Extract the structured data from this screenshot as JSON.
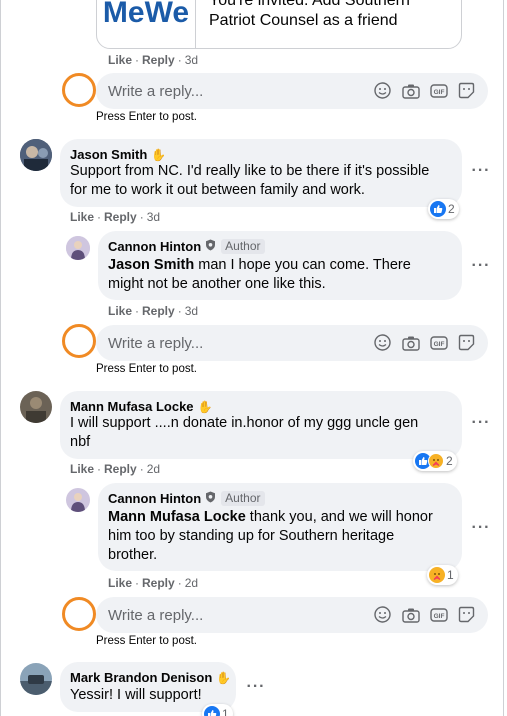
{
  "top_card": {
    "logo_text": "MeWe",
    "invite_line1": "You're invited. Add Southern",
    "invite_line2": "Patriot Counsel as a friend"
  },
  "comments": [
    {
      "id": "c0",
      "actions": {
        "like": "Like",
        "reply": "Reply",
        "time": "3d"
      },
      "reply_box": {
        "placeholder": "Write a reply...",
        "hint": "Press Enter to post."
      }
    },
    {
      "id": "c1",
      "author": "Jason Smith",
      "text": "Support from NC. I'd really like to be there if it's possible for me to work it out between family and work.",
      "text_line1": "Support from NC. I'd really like to be there if it's possible",
      "text_line2": "for me to work it out between family and work.",
      "actions": {
        "like": "Like",
        "reply": "Reply",
        "time": "3d"
      },
      "reaction_count": "2",
      "reply": {
        "author": "Cannon Hinton",
        "badge": "Author",
        "mention": "Jason Smith",
        "text_line1_rest": " man I hope you can come. There",
        "text_line2": "might not be another one like this.",
        "actions": {
          "like": "Like",
          "reply": "Reply",
          "time": "3d"
        }
      },
      "reply_box": {
        "placeholder": "Write a reply...",
        "hint": "Press Enter to post."
      }
    },
    {
      "id": "c2",
      "author": "Mann Mufasa Locke",
      "text_line1": "I will support ....n donate in.honor of my ggg uncle gen",
      "text_line2": "nbf",
      "actions": {
        "like": "Like",
        "reply": "Reply",
        "time": "2d"
      },
      "reaction_count": "2",
      "reply": {
        "author": "Cannon Hinton",
        "badge": "Author",
        "mention": "Mann Mufasa Locke",
        "text_line1_rest": " thank you, and we will honor",
        "text_line2": "him too by standing up for Southern heritage",
        "text_line3": "brother.",
        "actions": {
          "like": "Like",
          "reply": "Reply",
          "time": "2d"
        },
        "reaction_count": "1"
      },
      "reply_box": {
        "placeholder": "Write a reply...",
        "hint": "Press Enter to post."
      }
    },
    {
      "id": "c3",
      "author": "Mark Brandon Denison",
      "text": "Yessir! I will support!",
      "reaction_count": "1"
    }
  ],
  "colors": {
    "accent": "#1877f2",
    "annotation_ring": "#f08a24",
    "bubble": "#f0f2f5"
  }
}
